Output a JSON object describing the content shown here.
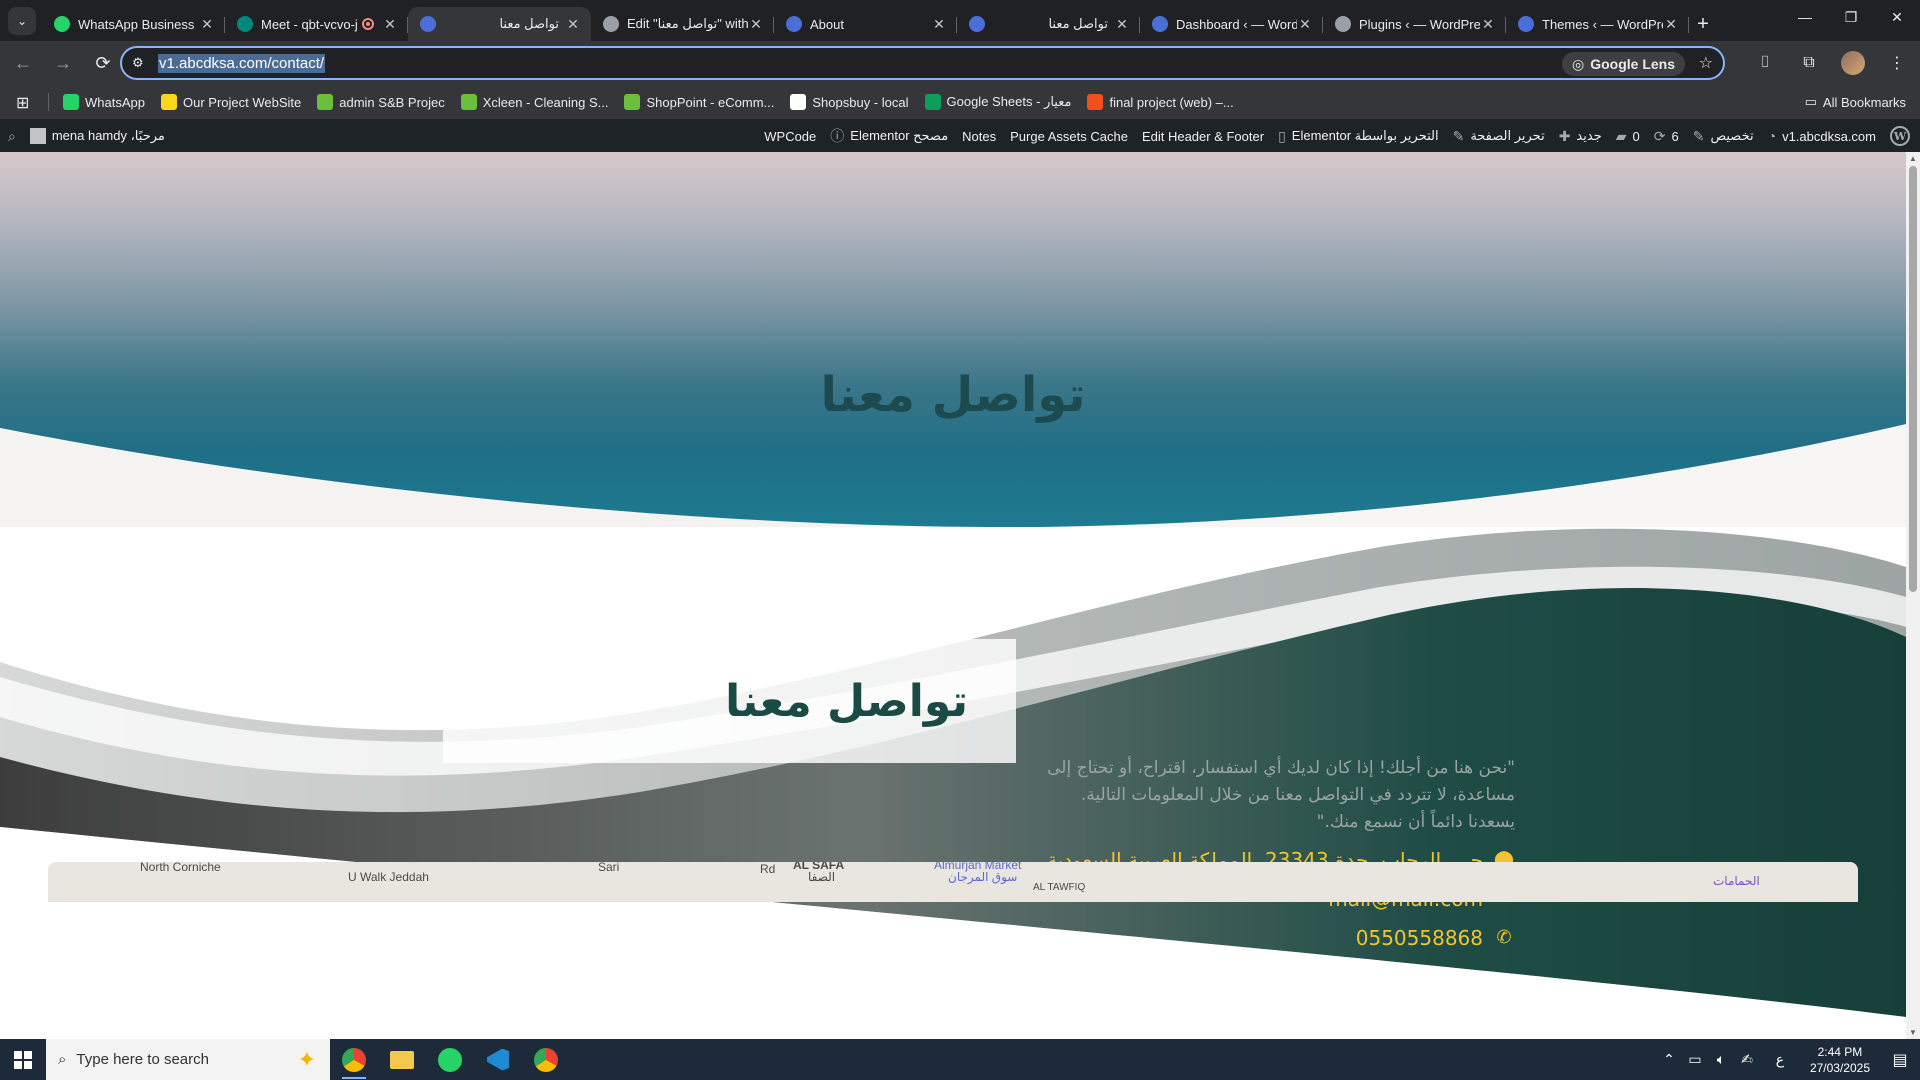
{
  "browser": {
    "tabs": [
      {
        "title": "WhatsApp Business",
        "favicon": "whatsapp-icon",
        "color": "#25d366",
        "active": false,
        "rtl": false
      },
      {
        "title": "Meet - qbt-vcvo-j",
        "favicon": "meet-icon",
        "color": "#00897b",
        "active": false,
        "rtl": false,
        "recording": true
      },
      {
        "title": "تواصل معنا",
        "favicon": "site-icon",
        "color": "#4a6fd8",
        "active": true,
        "rtl": true
      },
      {
        "title": "Edit \"تواصل معنا\" with",
        "favicon": "globe-icon",
        "color": "#9aa0a6",
        "active": false,
        "rtl": false
      },
      {
        "title": "About",
        "favicon": "site-icon",
        "color": "#4a6fd8",
        "active": false,
        "rtl": false
      },
      {
        "title": "تواصل معنا",
        "favicon": "site-icon",
        "color": "#4a6fd8",
        "active": false,
        "rtl": true
      },
      {
        "title": "Dashboard ‹ — Word",
        "favicon": "site-icon",
        "color": "#4a6fd8",
        "active": false,
        "rtl": false
      },
      {
        "title": "Plugins ‹ — WordPre",
        "favicon": "globe-icon",
        "color": "#9aa0a6",
        "active": false,
        "rtl": false
      },
      {
        "title": "Themes ‹ — WordPre",
        "favicon": "site-icon",
        "color": "#4a6fd8",
        "active": false,
        "rtl": false
      }
    ],
    "url": "v1.abcdksa.com/contact/",
    "lens_label": "Google Lens",
    "bookmarks": [
      {
        "label": "WhatsApp",
        "color": "#25d366"
      },
      {
        "label": "Our Project WebSite",
        "color": "#f9d71c"
      },
      {
        "label": "admin S&B Projec",
        "color": "#6bbf3a"
      },
      {
        "label": "Xcleen - Cleaning S...",
        "color": "#6bbf3a"
      },
      {
        "label": "ShopPoint - eComm...",
        "color": "#6bbf3a"
      },
      {
        "label": "Shopsbuy - local",
        "color": "#ffffff"
      },
      {
        "label": "Google Sheets - معيار",
        "color": "#0f9d58"
      },
      {
        "label": "final project (web) –...",
        "color": "#f24e1e"
      }
    ],
    "all_bookmarks": "All Bookmarks"
  },
  "wpbar": {
    "site": "v1.abcdksa.com",
    "customize": "تخصيص",
    "updates": "6",
    "comments": "0",
    "new": "جديد",
    "edit_page": "تحرير الصفحة",
    "elementor_edit": "التحرير بواسطة Elementor",
    "edit_header_footer": "Edit Header & Footer",
    "purge": "Purge Assets Cache",
    "notes": "Notes",
    "elementor_debugger": "مصحح Elementor",
    "wpcode": "WPCode",
    "greeting": "مرحبًا، mena hamdy"
  },
  "page": {
    "hero_title": "تواصل معنا",
    "section_title": "تواصل معنا",
    "description": "\"نحن هنا من أجلك! إذا كان لديك أي استفسار، اقتراح، أو تحتاج إلى مساعدة، لا تتردد في التواصل معنا من خلال المعلومات التالية. يسعدنا دائماً أن نسمع منك.\"",
    "address": "حي، الرحاب، جدة 23343، المملكة العربية السعودية",
    "email": "mail@mail.com",
    "phone": "0550558868",
    "accent_color": "#f4c430",
    "map_labels": [
      "North Corniche",
      "U Walk Jeddah",
      "Sari",
      "Rd",
      "AL SAFA",
      "الصفا",
      "Almurjan Market",
      "سوق المرجان",
      "AL TAWFIQ",
      "الحمامات"
    ]
  },
  "taskbar": {
    "search_placeholder": "Type here to search",
    "time": "2:44 PM",
    "date": "27/03/2025",
    "lang": "ع"
  }
}
